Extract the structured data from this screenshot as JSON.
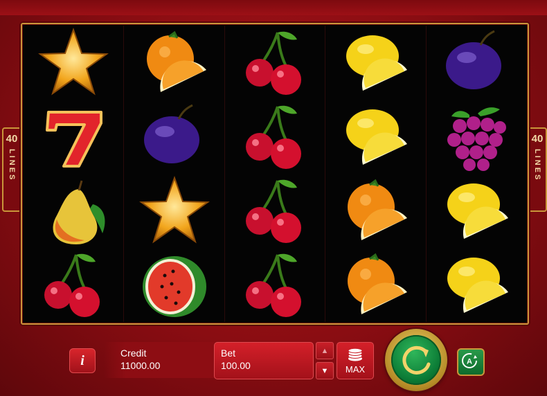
{
  "lines_badge": {
    "number": "40",
    "word": "LINES"
  },
  "reels": [
    [
      "star",
      "seven",
      "pear",
      "cherry"
    ],
    [
      "orange",
      "plum",
      "star",
      "watermelon"
    ],
    [
      "cherry",
      "cherry",
      "cherry",
      "cherry"
    ],
    [
      "lemon",
      "lemon",
      "orange",
      "orange"
    ],
    [
      "plum",
      "grapes",
      "lemon",
      "lemon"
    ]
  ],
  "credit": {
    "label": "Credit",
    "value": "11000.00"
  },
  "bet": {
    "label": "Bet",
    "value": "100.00"
  },
  "max_label": "MAX",
  "info_label": "i",
  "icons": {
    "info": "info-icon",
    "bet_up": "triangle-up-icon",
    "bet_down": "triangle-down-icon",
    "max": "coin-stack-icon",
    "spin": "circular-arrow-icon",
    "autoplay": "autoplay-a-icon"
  },
  "colors": {
    "background": "#9c1016",
    "frame": "#c9963a",
    "spin": "#0b7a35"
  }
}
